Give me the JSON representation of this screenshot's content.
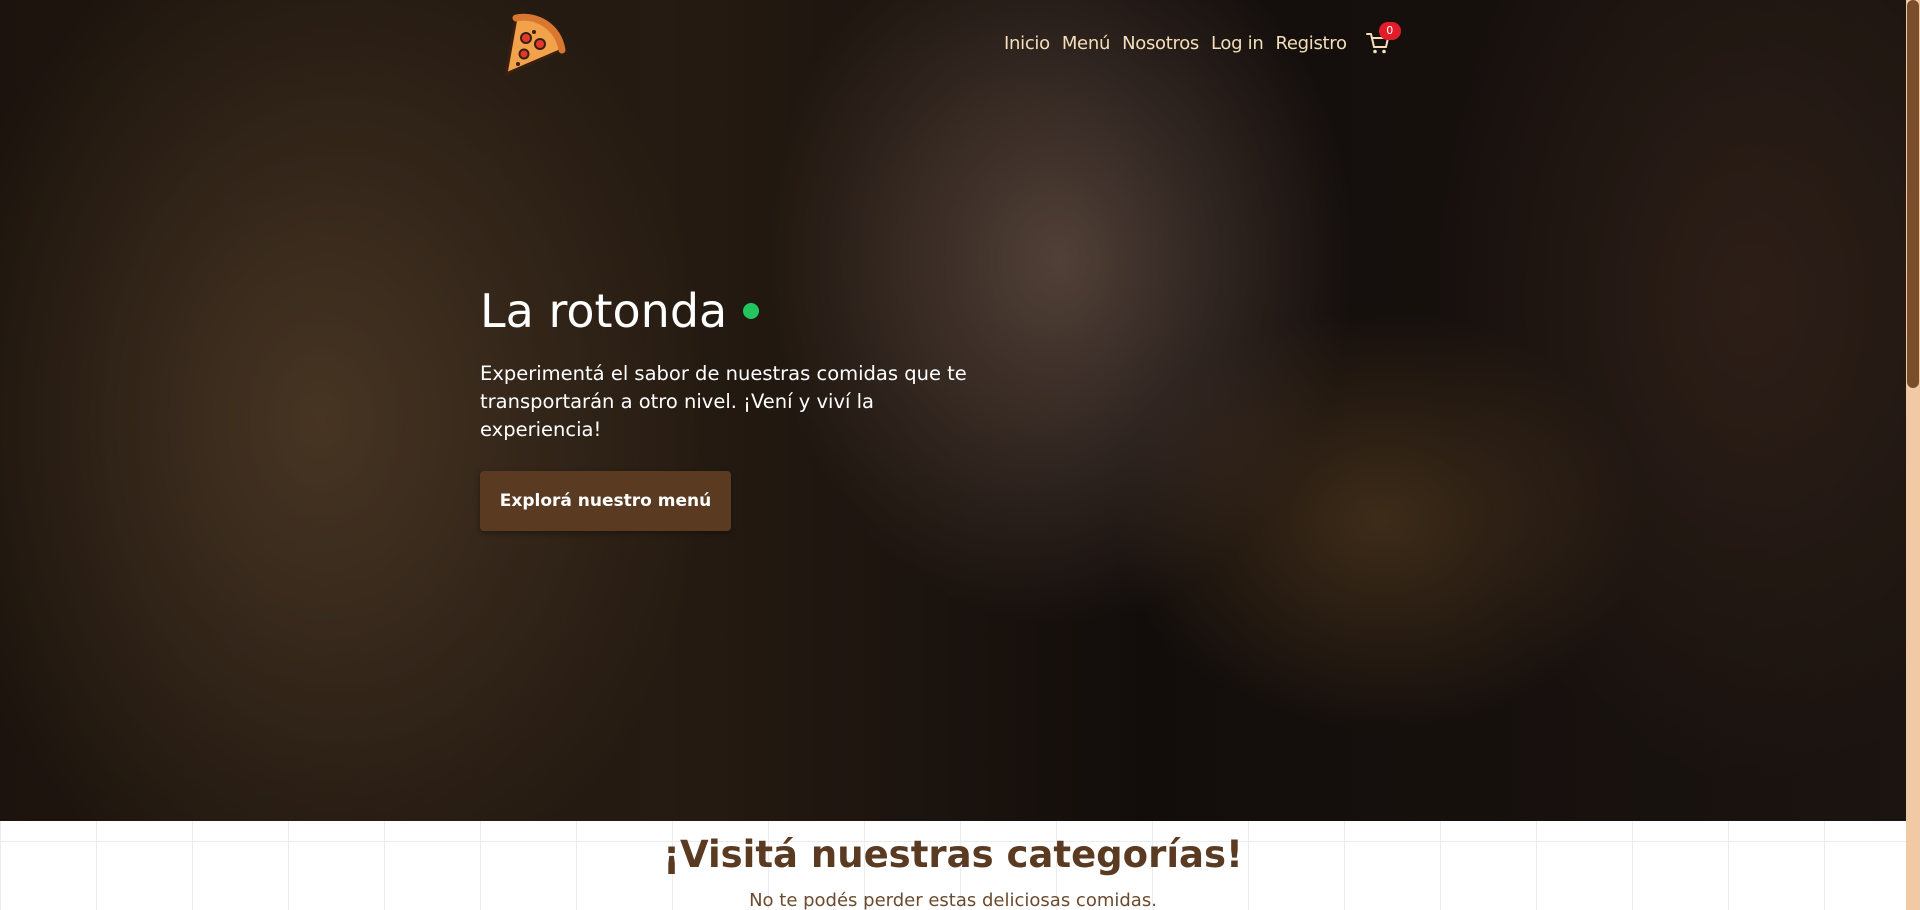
{
  "brand": {
    "logo_icon": "pizza-slice-icon"
  },
  "nav": {
    "items": [
      "Inicio",
      "Menú",
      "Nosotros",
      "Log in",
      "Registro"
    ],
    "cart_icon": "cart-icon",
    "cart_count": "0"
  },
  "hero": {
    "title": "La rotonda",
    "status_color": "#22c55e",
    "description": "Experimentá el sabor de nuestras comidas que te transportarán a otro nivel. ¡Vení y viví la experiencia!",
    "cta_label": "Explorá nuestro menú"
  },
  "categories": {
    "title": "¡Visitá nuestras categorías!",
    "subtitle": "No te podés perder estas deliciosas comidas."
  },
  "colors": {
    "accent": "#5b3a22",
    "nav_text": "#f4dfb9",
    "badge": "#e11d2a"
  }
}
